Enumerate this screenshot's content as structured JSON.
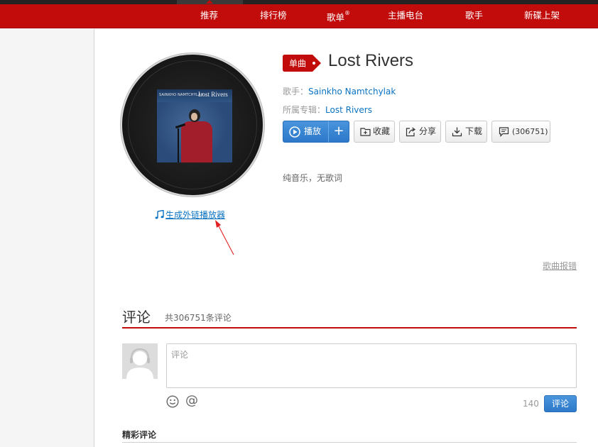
{
  "nav": {
    "items": [
      {
        "label": "推荐",
        "sup": ""
      },
      {
        "label": "排行榜",
        "sup": ""
      },
      {
        "label": "歌单",
        "sup": "®"
      },
      {
        "label": "主播电台",
        "sup": ""
      },
      {
        "label": "歌手",
        "sup": ""
      },
      {
        "label": "新碟上架",
        "sup": ""
      }
    ],
    "active_index": 0
  },
  "colors": {
    "brand_red": "#c20c0c",
    "link_blue": "#0c73c2",
    "button_blue": "#2d78c9"
  },
  "cover": {
    "artist_text": "SAINKHO NAMTCHYLAK",
    "title_text": "Lost Rivers"
  },
  "player_link": {
    "label": "生成外链播放器",
    "icon": "music-note-icon"
  },
  "song": {
    "tag": "单曲",
    "title": "Lost Rivers",
    "artist_label": "歌手：",
    "artist": "Sainkho Namtchylak",
    "album_label": "所属专辑：",
    "album": "Lost Rivers"
  },
  "actions": {
    "play": "播放",
    "add": "+",
    "collect": "收藏",
    "share": "分享",
    "download": "下载",
    "comment_count": "(306751)"
  },
  "lyric_note": "纯音乐，无歌词",
  "report_label": "歌曲报错",
  "comments": {
    "title": "评论",
    "count_text": "共306751条评论",
    "input_placeholder": "评论",
    "char_limit": "140",
    "submit": "评论",
    "at_symbol": "@",
    "hot_title": "精彩评论"
  }
}
